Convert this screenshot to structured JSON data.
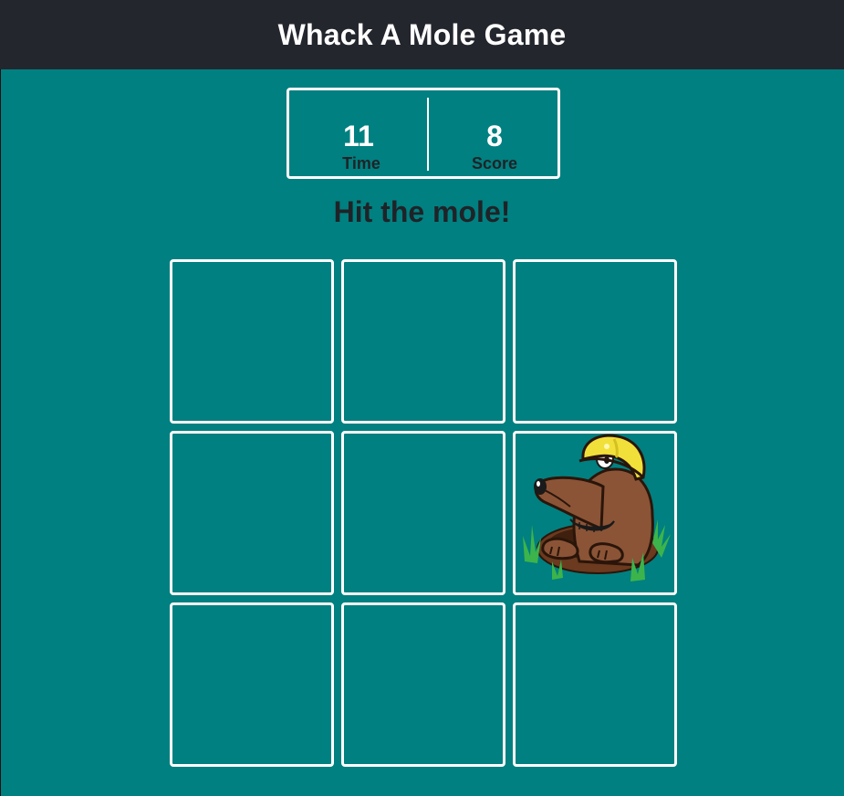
{
  "header": {
    "title": "Whack A Mole Game"
  },
  "stats": {
    "time_value": "11",
    "time_label": "Time",
    "score_value": "8",
    "score_label": "Score"
  },
  "message": "Hit the mole!",
  "grid": {
    "rows": 3,
    "cols": 3,
    "cells": [
      {
        "has_mole": false
      },
      {
        "has_mole": false
      },
      {
        "has_mole": false
      },
      {
        "has_mole": false
      },
      {
        "has_mole": false
      },
      {
        "has_mole": true,
        "icon": "mole-icon"
      },
      {
        "has_mole": false
      },
      {
        "has_mole": false
      },
      {
        "has_mole": false
      }
    ]
  },
  "colors": {
    "background": "#008080",
    "header_bg": "#24262e",
    "cell_border": "#ffffff",
    "mole_body": "#8b5436",
    "helmet": "#f2e03a",
    "grass": "#3cb44b"
  }
}
